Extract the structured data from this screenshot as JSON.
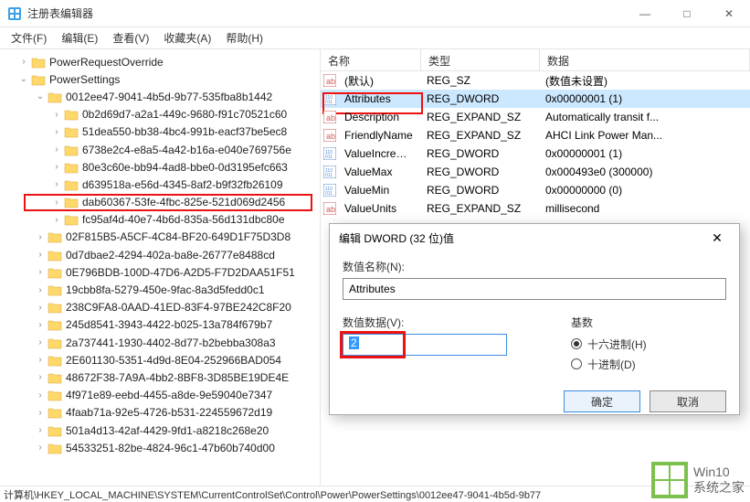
{
  "window": {
    "title": "注册表编辑器",
    "min": "—",
    "max": "□",
    "close": "✕"
  },
  "menu": {
    "file": "文件(F)",
    "edit": "编辑(E)",
    "view": "查看(V)",
    "fav": "收藏夹(A)",
    "help": "帮助(H)"
  },
  "tree": {
    "items": [
      {
        "indent": 1,
        "chev": "›",
        "label": "PowerRequestOverride"
      },
      {
        "indent": 1,
        "chev": "⌄",
        "label": "PowerSettings"
      },
      {
        "indent": 2,
        "chev": "⌄",
        "label": "0012ee47-9041-4b5d-9b77-535fba8b1442"
      },
      {
        "indent": 3,
        "chev": "›",
        "label": "0b2d69d7-a2a1-449c-9680-f91c70521c60"
      },
      {
        "indent": 3,
        "chev": "›",
        "label": "51dea550-bb38-4bc4-991b-eacf37be5ec8"
      },
      {
        "indent": 3,
        "chev": "›",
        "label": "6738e2c4-e8a5-4a42-b16a-e040e769756e"
      },
      {
        "indent": 3,
        "chev": "›",
        "label": "80e3c60e-bb94-4ad8-bbe0-0d3195efc663"
      },
      {
        "indent": 3,
        "chev": "›",
        "label": "d639518a-e56d-4345-8af2-b9f32fb26109"
      },
      {
        "indent": 3,
        "chev": "›",
        "label": "dab60367-53fe-4fbc-825e-521d069d2456",
        "red": true
      },
      {
        "indent": 3,
        "chev": "›",
        "label": "fc95af4d-40e7-4b6d-835a-56d131dbc80e"
      },
      {
        "indent": 2,
        "chev": "›",
        "label": "02F815B5-A5CF-4C84-BF20-649D1F75D3D8"
      },
      {
        "indent": 2,
        "chev": "›",
        "label": "0d7dbae2-4294-402a-ba8e-26777e8488cd"
      },
      {
        "indent": 2,
        "chev": "›",
        "label": "0E796BDB-100D-47D6-A2D5-F7D2DAA51F51"
      },
      {
        "indent": 2,
        "chev": "›",
        "label": "19cbb8fa-5279-450e-9fac-8a3d5fedd0c1"
      },
      {
        "indent": 2,
        "chev": "›",
        "label": "238C9FA8-0AAD-41ED-83F4-97BE242C8F20"
      },
      {
        "indent": 2,
        "chev": "›",
        "label": "245d8541-3943-4422-b025-13a784f679b7"
      },
      {
        "indent": 2,
        "chev": "›",
        "label": "2a737441-1930-4402-8d77-b2bebba308a3"
      },
      {
        "indent": 2,
        "chev": "›",
        "label": "2E601130-5351-4d9d-8E04-252966BAD054"
      },
      {
        "indent": 2,
        "chev": "›",
        "label": "48672F38-7A9A-4bb2-8BF8-3D85BE19DE4E"
      },
      {
        "indent": 2,
        "chev": "›",
        "label": "4f971e89-eebd-4455-a8de-9e59040e7347"
      },
      {
        "indent": 2,
        "chev": "›",
        "label": "4faab71a-92e5-4726-b531-224559672d19"
      },
      {
        "indent": 2,
        "chev": "›",
        "label": "501a4d13-42af-4429-9fd1-a8218c268e20"
      },
      {
        "indent": 2,
        "chev": "›",
        "label": "54533251-82be-4824-96c1-47b60b740d00"
      }
    ]
  },
  "list": {
    "headers": {
      "name": "名称",
      "type": "类型",
      "data": "数据"
    },
    "rows": [
      {
        "icon": "str",
        "name": "(默认)",
        "type": "REG_SZ",
        "data": "(数值未设置)"
      },
      {
        "icon": "bin",
        "name": "Attributes",
        "type": "REG_DWORD",
        "data": "0x00000001 (1)",
        "selected": true,
        "red": true
      },
      {
        "icon": "str",
        "name": "Description",
        "type": "REG_EXPAND_SZ",
        "data": "Automatically transit f..."
      },
      {
        "icon": "str",
        "name": "FriendlyName",
        "type": "REG_EXPAND_SZ",
        "data": "AHCI Link Power Man..."
      },
      {
        "icon": "bin",
        "name": "ValueIncrement",
        "type": "REG_DWORD",
        "data": "0x00000001 (1)"
      },
      {
        "icon": "bin",
        "name": "ValueMax",
        "type": "REG_DWORD",
        "data": "0x000493e0 (300000)"
      },
      {
        "icon": "bin",
        "name": "ValueMin",
        "type": "REG_DWORD",
        "data": "0x00000000 (0)"
      },
      {
        "icon": "str",
        "name": "ValueUnits",
        "type": "REG_EXPAND_SZ",
        "data": "millisecond"
      }
    ]
  },
  "dialog": {
    "title": "编辑 DWORD (32 位)值",
    "name_label": "数值名称(N):",
    "name_value": "Attributes",
    "data_label": "数值数据(V):",
    "data_value": "2",
    "base_label": "基数",
    "hex_label": "十六进制(H)",
    "dec_label": "十进制(D)",
    "ok": "确定",
    "cancel": "取消",
    "close": "✕"
  },
  "statusbar": {
    "path": "计算机\\HKEY_LOCAL_MACHINE\\SYSTEM\\CurrentControlSet\\Control\\Power\\PowerSettings\\0012ee47-9041-4b5d-9b77"
  },
  "watermark": {
    "line1": "Win10",
    "line2": "系统之家"
  }
}
